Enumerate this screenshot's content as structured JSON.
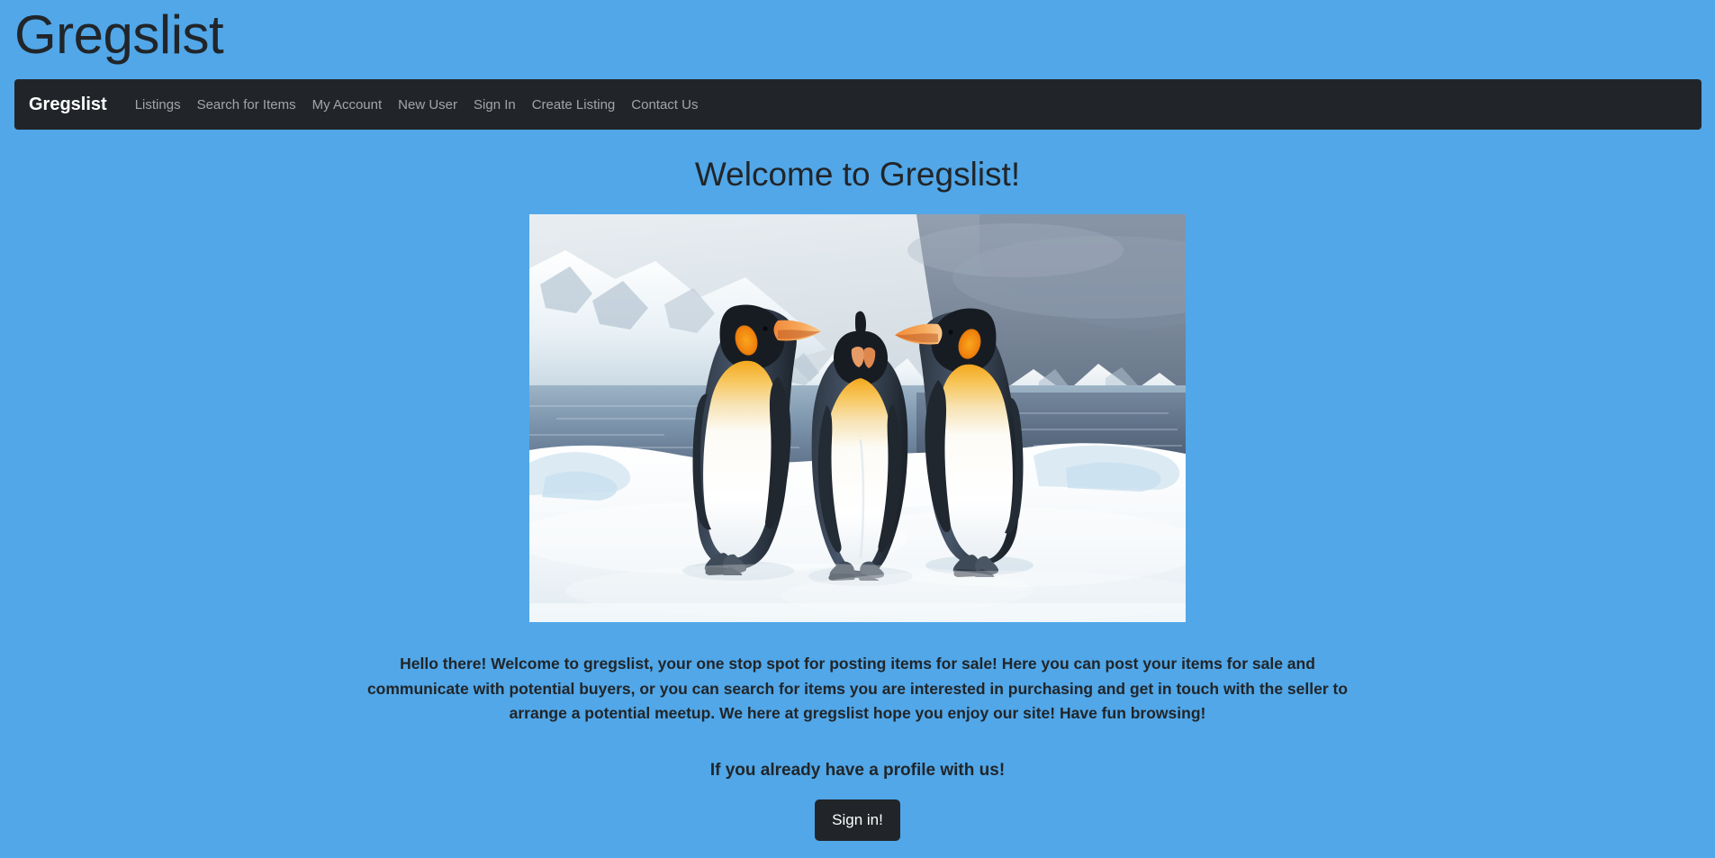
{
  "page": {
    "title": "Gregslist",
    "background_color": "#51a7e8",
    "text_color": "#212529"
  },
  "navbar": {
    "background_color": "#212529",
    "brand": "Gregslist",
    "links": [
      {
        "label": "Listings"
      },
      {
        "label": "Search for Items"
      },
      {
        "label": "My Account"
      },
      {
        "label": "New User"
      },
      {
        "label": "Sign In"
      },
      {
        "label": "Create Listing"
      },
      {
        "label": "Contact Us"
      }
    ]
  },
  "main": {
    "heading": "Welcome to Gregslist!",
    "hero_image_alt": "Three king penguins standing on snow in front of an icy bay and snow covered mountains",
    "intro_paragraph": "Hello there! Welcome to gregslist, your one stop spot for posting items for sale! Here you can post your items for sale and communicate with potential buyers, or you can search for items you are interested in purchasing and get in touch with the seller to arrange a potential meetup. We here at gregslist hope you enjoy our site! Have fun browsing!",
    "signin_prompt": "If you already have a profile with us!",
    "signin_button_label": "Sign in!"
  }
}
